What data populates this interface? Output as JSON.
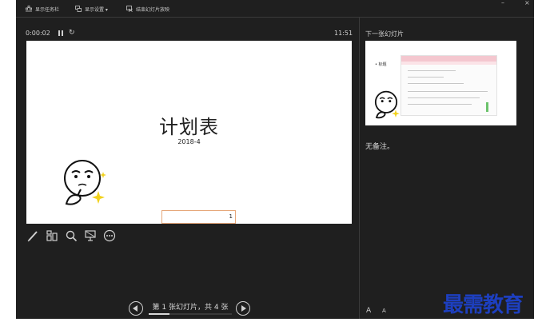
{
  "toolbar": {
    "show_taskbar": "显示任务栏",
    "display_settings": "显示设置 ▾",
    "end_slideshow": "结束幻灯片放映"
  },
  "window_controls": {
    "minimize": "–",
    "close": "×"
  },
  "status": {
    "timer": "0:00:02",
    "clock": "11:51"
  },
  "current_slide": {
    "title": "计划表",
    "subtitle": "2018-4",
    "textbox_text": "1"
  },
  "next_slide": {
    "label": "下一张幻灯片",
    "bullet": "• 标题"
  },
  "notes": {
    "text": "无备注。"
  },
  "navigation": {
    "counter": "第 1 张幻灯片，共 4 张",
    "current": 1,
    "total": 4
  },
  "font_controls": {
    "increase": "A",
    "decrease": "A"
  },
  "tools": [
    "pen-icon",
    "see-all-slides-icon",
    "zoom-icon",
    "black-screen-icon",
    "more-options-icon"
  ],
  "icons": {
    "pause": "pause-icon",
    "restart": "restart-icon",
    "prev": "previous-slide-icon",
    "next": "next-slide-icon"
  },
  "colors": {
    "background": "#1f1f1f",
    "slide": "#ffffff",
    "watermark": "#1d3fbf",
    "textbox_border": "#e6a77a"
  },
  "watermark": "最需教育"
}
